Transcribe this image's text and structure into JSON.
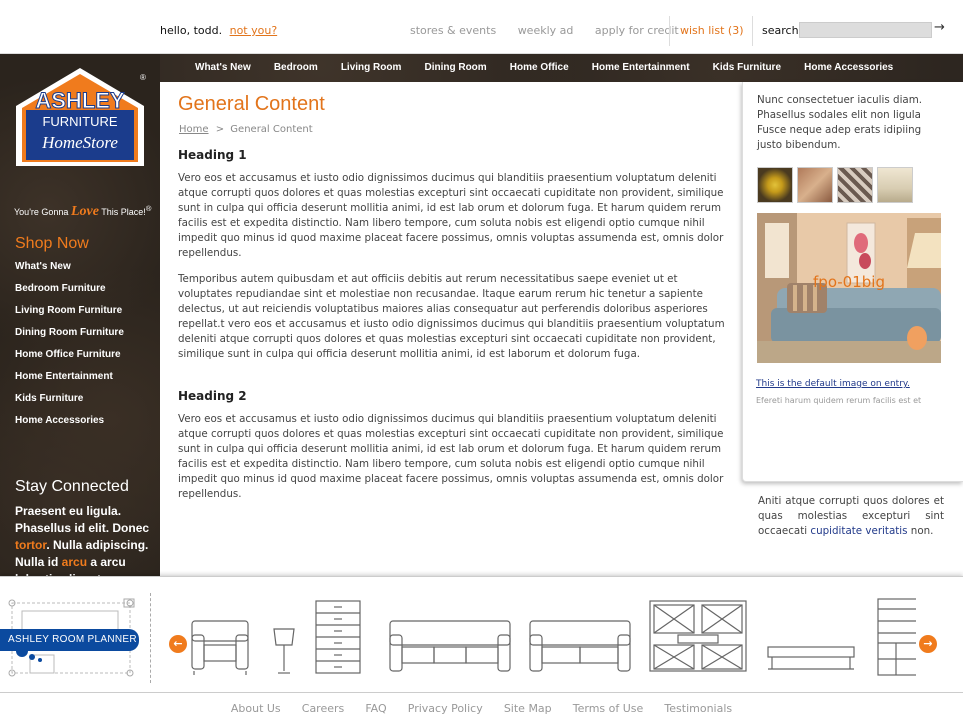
{
  "header": {
    "greeting": "hello, todd.",
    "not_you": "not you?",
    "util_links": [
      "stores & events",
      "weekly ad",
      "apply for credit"
    ],
    "wish_list": "wish list (3)",
    "search_label": "search",
    "search_value": "",
    "search_go_glyph": "→"
  },
  "nav": [
    "What's New",
    "Bedroom",
    "Living Room",
    "Dining Room",
    "Home Office",
    "Home Entertainment",
    "Kids Furniture",
    "Home Accessories"
  ],
  "sidebar": {
    "logo": {
      "line1": "ASHLEY",
      "line2": "FURNITURE",
      "line3": "HomeStore",
      "reg": "®"
    },
    "tagline_pre": "You're Gonna",
    "tagline_love": "Love",
    "tagline_post": "This Place!",
    "tagline_mark": "®",
    "shop_now": "Shop Now",
    "shop_items": [
      "What's New",
      "Bedroom Furniture",
      "Living Room Furniture",
      "Dining Room Furniture",
      "Home Office Furniture",
      "Home Entertainment",
      "Kids Furniture",
      "Home Accessories"
    ],
    "stay_connected": "Stay Connected",
    "stay_text": {
      "t1": "Praesent eu ligula. Phasellus id elit. Donec ",
      "o1": "tortor",
      "t2": ". Nulla adipiscing. Nulla id ",
      "o2": "arcu",
      "t3": " a arcu lobortis aliquet."
    }
  },
  "content": {
    "title": "General Content",
    "breadcrumb_home": "Home",
    "breadcrumb_sep": ">",
    "breadcrumb_current": "General Content",
    "heading1": "Heading 1",
    "p1": "Vero eos et accusamus et iusto odio dignissimos ducimus qui blanditiis praesentium voluptatum deleniti atque corrupti quos dolores et quas molestias excepturi sint occaecati cupiditate non provident, similique sunt in culpa qui officia deserunt mollitia animi, id est lab orum et dolorum fuga. Et harum quidem rerum facilis est et expedita distinctio. Nam libero tempore, cum soluta nobis est eligendi optio cumque nihil impedit quo minus id quod maxime placeat facere possimus, omnis voluptas assumenda est, omnis dolor repellendus.",
    "p2": "Temporibus autem quibusdam et aut officiis debitis aut rerum necessitatibus saepe eveniet ut et voluptates repudiandae sint et molestiae non recusandae. Itaque earum rerum hic tenetur a sapiente delectus, ut aut reiciendis voluptatibus maiores alias consequatur aut perferendis doloribus asperiores repellat.t vero eos et accusamus et iusto odio dignissimos ducimus qui blanditiis praesentium voluptatum deleniti atque corrupti quos dolores et quas molestias excepturi sint occaecati cupiditate non provident, similique sunt in culpa qui officia deserunt mollitia animi, id est laborum et dolorum fuga.",
    "heading2": "Heading 2",
    "p3": "Vero eos et accusamus et iusto odio dignissimos ducimus qui blanditiis praesentium voluptatum deleniti atque corrupti quos dolores et quas molestias excepturi sint occaecati cupiditate non provident, similique sunt in culpa qui officia deserunt mollitia animi, id est lab orum et dolorum fuga. Et harum quidem rerum facilis est et expedita distinctio. Nam libero tempore, cum soluta nobis est eligendi optio cumque nihil impedit quo minus id quod maxime placeat facere possimus, omnis voluptas assumenda est, omnis dolor repellendus."
  },
  "right": {
    "intro": "Nunc consectetuer iaculis diam. Phasellus sodales elit non ligula Fusce neque adep erats idipiing justo bibendum.",
    "image_label": "fpo-01big",
    "default_link": "This is the default image on entry.",
    "caption": "Efereti harum quidem rerum facilis est et",
    "lower_text": "Aniti atque corrupti quos dolores et quas molestias excepturi sint occaecati ",
    "lower_link": "cupiditate veritatis",
    "lower_end": " non."
  },
  "planner": {
    "label": "ASHLEY ROOM PLANNER",
    "prev_glyph": "←",
    "next_glyph": "→"
  },
  "footer": [
    "About Us",
    "Careers",
    "FAQ",
    "Privacy Policy",
    "Site Map",
    "Terms of Use",
    "Testimonials"
  ],
  "colors": {
    "accent": "#e2741b",
    "brand_blue": "#0b4a9f",
    "dark_bg": "#2b241d"
  }
}
